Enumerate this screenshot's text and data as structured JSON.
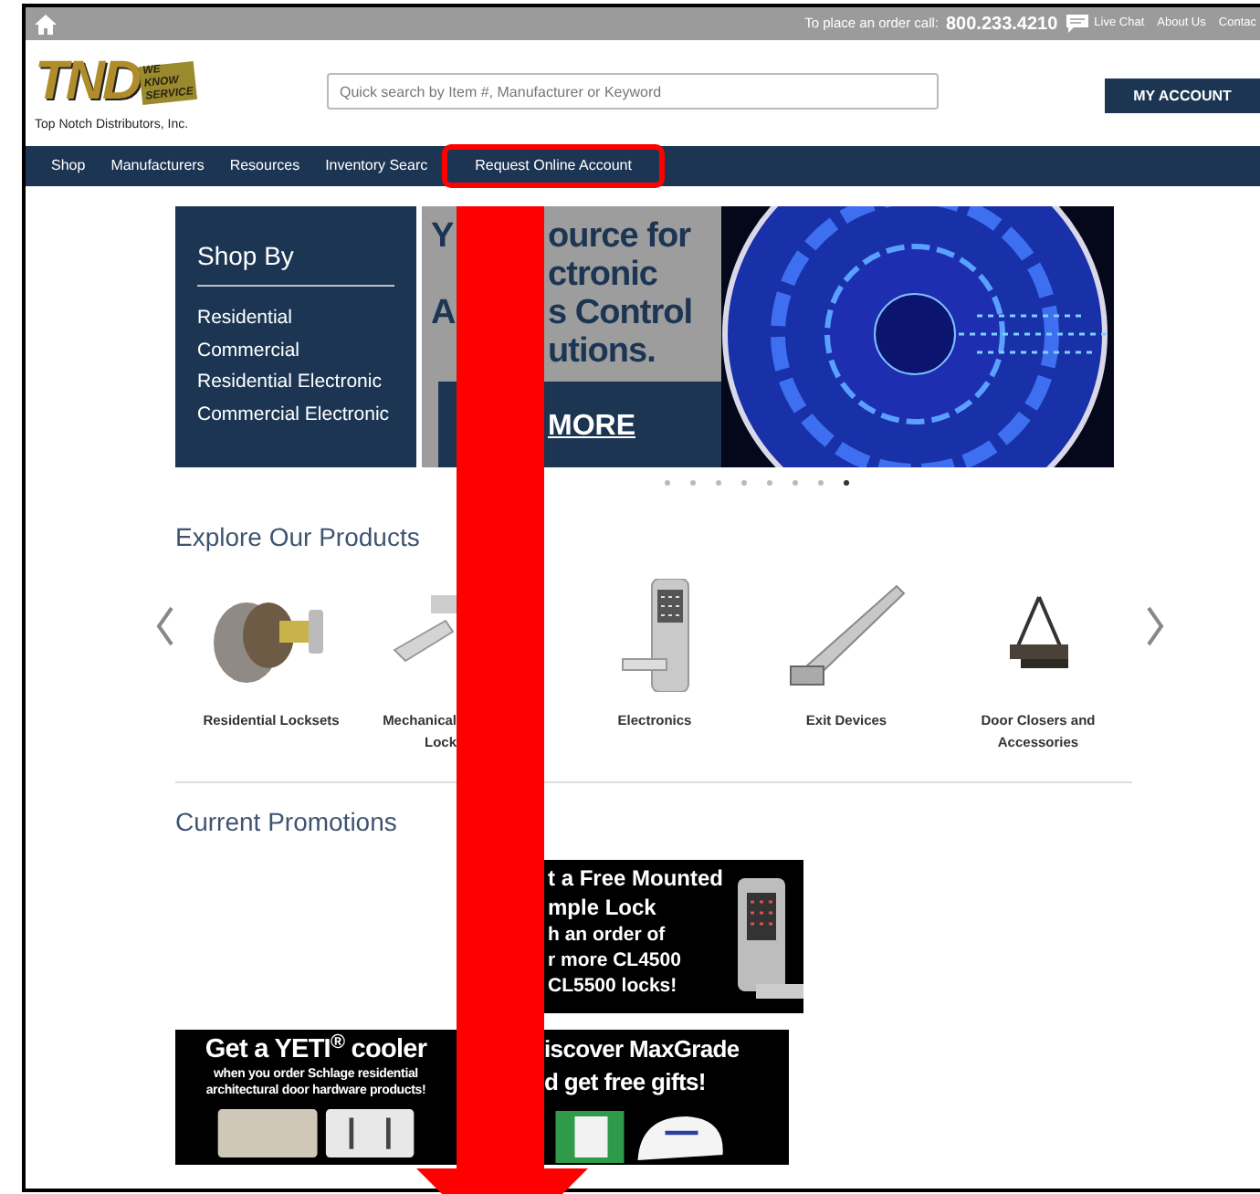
{
  "top_bar": {
    "order_label": "To place an order call:",
    "phone": "800.233.4210",
    "links": [
      "Live Chat",
      "About Us",
      "Contac"
    ]
  },
  "header": {
    "logo_mark": "TND",
    "logo_badge": [
      "WE",
      "KNOW",
      "SERVICE"
    ],
    "company_name": "Top Notch Distributors, Inc.",
    "search": {
      "placeholder": "Quick search by Item #, Manufacturer or Keyword"
    },
    "account_button": "MY ACCOUNT"
  },
  "nav": [
    {
      "label": "Shop",
      "circled": false
    },
    {
      "label": "Manufacturers",
      "circled": false
    },
    {
      "label": "Resources",
      "circled": false
    },
    {
      "label": "Inventory Searc",
      "circled": false
    },
    {
      "label": "Request Online Account",
      "circled": true
    }
  ],
  "shop_by": {
    "title": "Shop By",
    "items": [
      "Residential",
      "Commercial",
      "Residential Electronic",
      "Commercial Electronic"
    ]
  },
  "hero": {
    "lines": [
      {
        "left": "Y",
        "right": "ource for"
      },
      {
        "right": "ctronic"
      },
      {
        "left": "A",
        "right": "s Control"
      },
      {
        "right": "utions."
      }
    ],
    "cta": "MORE"
  },
  "carousel_dots": [
    {
      "selected": false
    },
    {
      "selected": false
    },
    {
      "selected": false
    },
    {
      "selected": false
    },
    {
      "selected": false
    },
    {
      "selected": false
    },
    {
      "selected": false
    },
    {
      "selected": true
    }
  ],
  "products": {
    "title": "Explore Our Products",
    "items": [
      {
        "kind": "knob",
        "label_lines": [
          "Residential Locksets"
        ]
      },
      {
        "kind": "lever",
        "label_lines": [
          "Mechanical",
          "Lock"
        ]
      },
      {
        "kind": "keypad",
        "label_lines": [
          "Electronics"
        ]
      },
      {
        "kind": "exit",
        "label_lines": [
          "Exit Devices"
        ]
      },
      {
        "kind": "closer",
        "label_lines": [
          "Door Closers and",
          "Accessories"
        ]
      }
    ]
  },
  "promotions": {
    "title": "Current Promotions",
    "banners": [
      {
        "kind": "lock",
        "lines": [
          "t a Free Mounted",
          "mple Lock",
          "h an order of",
          "r more CL4500",
          "CL5500 locks!"
        ]
      },
      {
        "kind": "yeti",
        "lines": [
          "Get a YETI$^{®}$ cooler",
          "when you order Schlage residential",
          "architectural door hardware products!"
        ]
      },
      {
        "kind": "maxgrade",
        "lines": [
          "iscover MaxGrade",
          "d get free gifts!"
        ]
      }
    ]
  }
}
